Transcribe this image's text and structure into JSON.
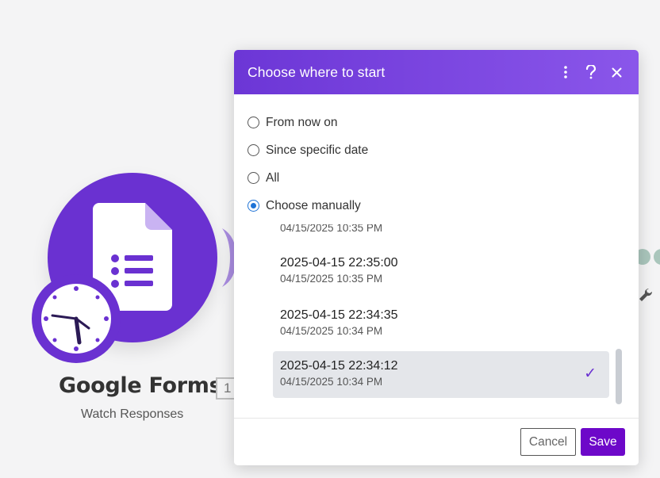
{
  "background": {
    "module_name": "Google Forms",
    "module_badge": "1",
    "module_subtitle": "Watch Responses",
    "icons": [
      "google-forms-icon",
      "clock-icon",
      "wrench-icon"
    ],
    "brand_color": "#6a31d1"
  },
  "dialog": {
    "title": "Choose where to start",
    "header_icons": [
      "more-vertical-icon",
      "help-icon",
      "close-icon"
    ],
    "options": [
      {
        "label": "From now on",
        "checked": false
      },
      {
        "label": "Since specific date",
        "checked": false
      },
      {
        "label": "All",
        "checked": false
      },
      {
        "label": "Choose manually",
        "checked": true
      }
    ],
    "records": [
      {
        "main": "",
        "sub": "04/15/2025 10:35 PM",
        "selected": false
      },
      {
        "main": "2025-04-15 22:35:00",
        "sub": "04/15/2025 10:35 PM",
        "selected": false
      },
      {
        "main": "2025-04-15 22:34:35",
        "sub": "04/15/2025 10:34 PM",
        "selected": false
      },
      {
        "main": "2025-04-15 22:34:12",
        "sub": "04/15/2025 10:34 PM",
        "selected": true
      }
    ],
    "selected_check": "✓",
    "cancel_label": "Cancel",
    "save_label": "Save",
    "header_gradient": [
      "#6c36d6",
      "#8a56ea"
    ],
    "save_color": "#6d08c9"
  }
}
